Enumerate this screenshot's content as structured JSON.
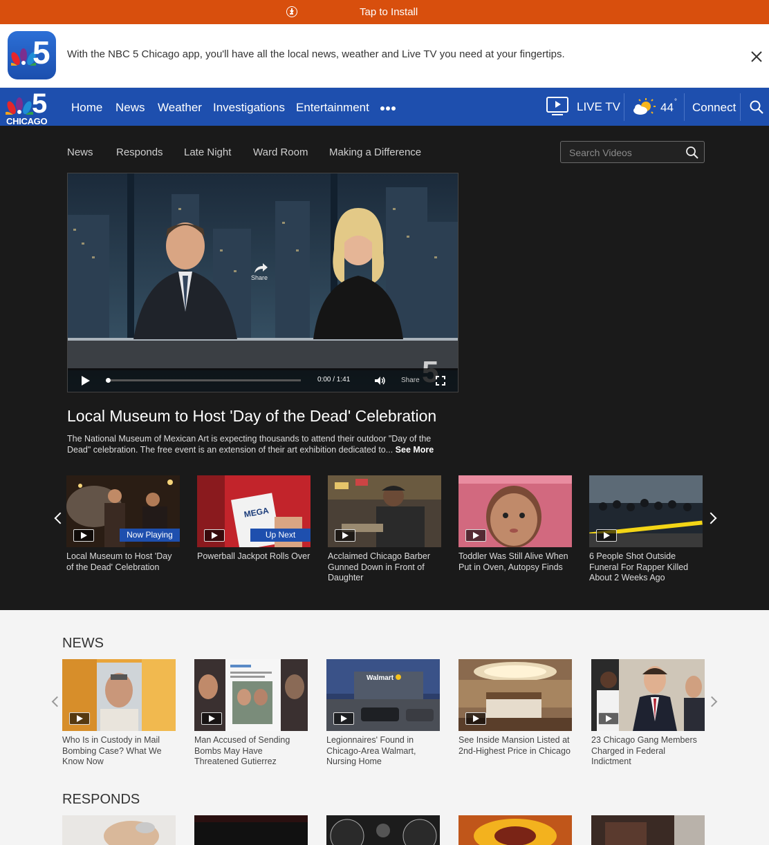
{
  "install_bar": {
    "label": "Tap to Install"
  },
  "app_banner": {
    "message": "With the NBC 5 Chicago app, you'll have all the local news, weather and Live TV you need at your fingertips.",
    "icon_text": "5"
  },
  "main_nav": {
    "logo_number": "5",
    "logo_city": "CHICAGO",
    "items": [
      "Home",
      "News",
      "Weather",
      "Investigations",
      "Entertainment"
    ],
    "live_tv": "LIVE TV",
    "temperature": "44",
    "degree": "°",
    "connect": "Connect"
  },
  "sub_nav": {
    "items": [
      "News",
      "Responds",
      "Late Night",
      "Ward Room",
      "Making a Difference"
    ],
    "search_placeholder": "Search Videos"
  },
  "player": {
    "share_label": "Share",
    "time": "0:00 / 1:41",
    "share_control": "Share",
    "progress": 0.0
  },
  "featured": {
    "title": "Local Museum to Host 'Day of the Dead' Celebration",
    "description": "The National Museum of Mexican Art is expecting thousands to attend their outdoor \"Day of the Dead\" celebration. The free event is an extension of their art exhibition dedicated to...",
    "see_more": "See More"
  },
  "video_carousel": [
    {
      "caption": "Local Museum to Host 'Day of the Dead' Celebration",
      "badge": "Now Playing"
    },
    {
      "caption": "Powerball Jackpot Rolls Over",
      "badge": "Up Next"
    },
    {
      "caption": "Acclaimed Chicago Barber Gunned Down in Front of Daughter",
      "badge": ""
    },
    {
      "caption": "Toddler Was Still Alive When Put in Oven, Autopsy Finds",
      "badge": ""
    },
    {
      "caption": "6 People Shot Outside Funeral For Rapper Killed About 2 Weeks Ago",
      "badge": ""
    }
  ],
  "news_section": {
    "title": "NEWS",
    "items": [
      "Who Is in Custody in Mail Bombing Case? What We Know Now",
      "Man Accused of Sending Bombs May Have Threatened Gutierrez",
      "Legionnaires' Found in Chicago-Area Walmart, Nursing Home",
      "See Inside Mansion Listed at 2nd-Highest Price in Chicago",
      "23 Chicago Gang Members Charged in Federal Indictment"
    ]
  },
  "responds_section": {
    "title": "RESPONDS"
  },
  "thumb_text": {
    "mega": "MEGA",
    "walmart": "Walmart"
  },
  "colors": {
    "brand_blue": "#1e4fae",
    "install_orange": "#d84f0d",
    "dark_bg": "#1a1a1a"
  }
}
